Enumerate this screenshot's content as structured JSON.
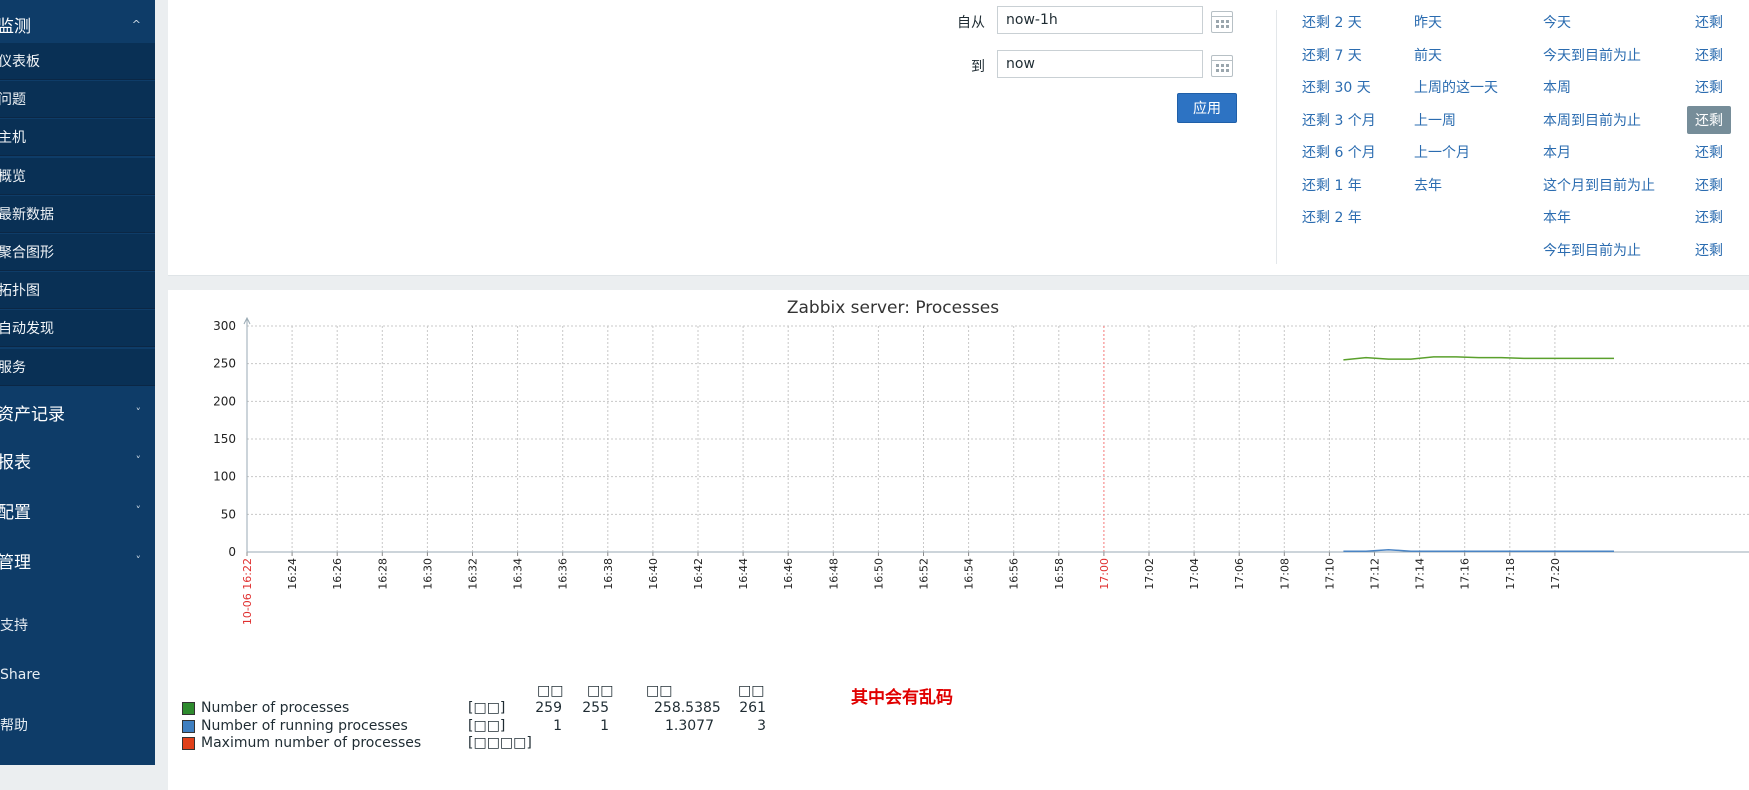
{
  "sidebar": {
    "monitoring": {
      "label": "监测",
      "chevron": "^"
    },
    "monitoring_items": [
      "仪表板",
      "问题",
      "主机",
      "概览",
      "最新数据",
      "聚合图形",
      "拓扑图",
      "自动发现",
      "服务"
    ],
    "sections": [
      {
        "label": "资产记录",
        "chevron": "˅"
      },
      {
        "label": "报表",
        "chevron": "˅"
      },
      {
        "label": "配置",
        "chevron": "˅"
      },
      {
        "label": "管理",
        "chevron": "˅"
      }
    ],
    "bottom": [
      "支持",
      "Share",
      "帮助"
    ]
  },
  "filter": {
    "from_label": "自从",
    "from_value": "now-1h",
    "to_label": "到",
    "to_value": "now",
    "apply_label": "应用",
    "quick_ranges": [
      [
        "还剩 2 天",
        "还剩 7 天",
        "还剩 30 天",
        "还剩 3 个月",
        "还剩 6 个月",
        "还剩 1 年",
        "还剩 2 年"
      ],
      [
        "昨天",
        "前天",
        "上周的这一天",
        "上一周",
        "上一个月",
        "去年"
      ],
      [
        "今天",
        "今天到目前为止",
        "本周",
        "本周到目前为止",
        "本月",
        "这个月到目前为止",
        "本年",
        "今年到目前为止"
      ],
      [
        "还剩",
        "还剩",
        "还剩",
        "还剩",
        "还剩",
        "还剩",
        "还剩",
        "还剩"
      ]
    ],
    "active_quick_range": "还剩"
  },
  "graph": {
    "legend_headers": [
      "最新",
      "最小",
      "平均",
      "最大"
    ],
    "legend_header_glyphs": [
      "□□",
      "□□",
      "□□",
      "□□"
    ],
    "legend": [
      {
        "name": "Number of processes",
        "color": "#2e8b2e",
        "unit": "[□□]",
        "values": [
          "259",
          "255",
          "258.5385",
          "261"
        ]
      },
      {
        "name": "Number of running processes",
        "color": "#3f7fc0",
        "unit": "[□□]",
        "values": [
          "1",
          "1",
          "1.3077",
          "3"
        ]
      },
      {
        "name": "Maximum number of processes",
        "color": "#e0401a",
        "unit": "[□□□□]",
        "values": [
          "",
          "",
          "",
          ""
        ]
      }
    ],
    "note": "其中会有乱码"
  },
  "chart_data": {
    "type": "line",
    "title": "Zabbix server: Processes",
    "ylim": [
      0,
      300
    ],
    "y_ticks": [
      0,
      50,
      100,
      150,
      200,
      250,
      300
    ],
    "x_ticks": [
      "10-06 16:22",
      "16:24",
      "16:26",
      "16:28",
      "16:30",
      "16:32",
      "16:34",
      "16:36",
      "16:38",
      "16:40",
      "16:42",
      "16:44",
      "16:46",
      "16:48",
      "16:50",
      "16:52",
      "16:54",
      "16:56",
      "16:58",
      "17:00",
      "17:02",
      "17:04",
      "17:06",
      "17:08",
      "17:10",
      "17:12",
      "17:14",
      "17:16",
      "17:18",
      "17:20"
    ],
    "x_tick_red": [
      "10-06 16:22",
      "17:00"
    ],
    "grid": true,
    "series": [
      {
        "name": "Number of processes",
        "color": "#5aa02c",
        "x": [
          "17:10",
          "17:11",
          "17:12",
          "17:13",
          "17:14",
          "17:15",
          "17:16",
          "17:17",
          "17:18",
          "17:19",
          "17:20",
          "17:21",
          "17:22"
        ],
        "values": [
          255,
          258,
          256,
          256,
          259,
          259,
          258,
          258,
          257,
          257,
          257,
          257,
          257
        ]
      },
      {
        "name": "Number of running processes",
        "color": "#4a84c4",
        "x": [
          "17:10",
          "17:11",
          "17:12",
          "17:13",
          "17:14",
          "17:15",
          "17:16",
          "17:17",
          "17:18",
          "17:19",
          "17:20",
          "17:21",
          "17:22"
        ],
        "values": [
          1,
          1,
          3,
          1,
          1,
          1,
          1,
          1,
          1,
          1,
          1,
          1,
          1
        ]
      }
    ]
  }
}
